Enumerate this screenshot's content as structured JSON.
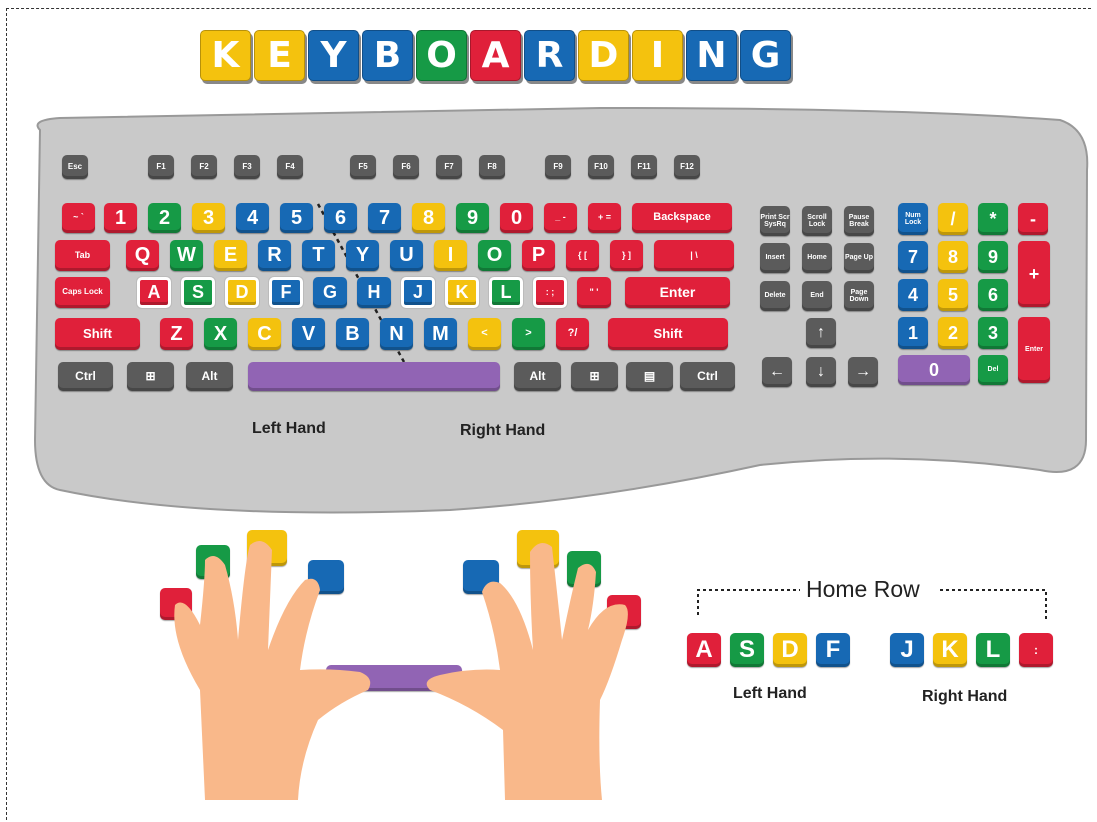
{
  "title": {
    "letters": [
      {
        "char": "K",
        "color": "#f4c20e"
      },
      {
        "char": "E",
        "color": "#f4c20e"
      },
      {
        "char": "Y",
        "color": "#1769b4"
      },
      {
        "char": "B",
        "color": "#1769b4"
      },
      {
        "char": "O",
        "color": "#169a46"
      },
      {
        "char": "A",
        "color": "#e0203a"
      },
      {
        "char": "R",
        "color": "#1769b4"
      },
      {
        "char": "D",
        "color": "#f4c20e"
      },
      {
        "char": "I",
        "color": "#f4c20e"
      },
      {
        "char": "N",
        "color": "#1769b4"
      },
      {
        "char": "G",
        "color": "#1769b4"
      }
    ]
  },
  "colors": {
    "red": "#e0203a",
    "green": "#169a46",
    "yellow": "#f4c20e",
    "blue": "#1769b4",
    "gray": "#5b5b5b",
    "purple": "#9164b4",
    "keyboard_body": "#c9c9c9",
    "skin": "#f9b88a"
  },
  "keyboard": {
    "rows": [
      [
        {
          "label": "Esc",
          "color": "gray"
        },
        {
          "label": "F1",
          "color": "gray"
        },
        {
          "label": "F2",
          "color": "gray"
        },
        {
          "label": "F3",
          "color": "gray"
        },
        {
          "label": "F4",
          "color": "gray"
        },
        {
          "label": "F5",
          "color": "gray"
        },
        {
          "label": "F6",
          "color": "gray"
        },
        {
          "label": "F7",
          "color": "gray"
        },
        {
          "label": "F8",
          "color": "gray"
        },
        {
          "label": "F9",
          "color": "gray"
        },
        {
          "label": "F10",
          "color": "gray"
        },
        {
          "label": "F11",
          "color": "gray"
        },
        {
          "label": "F12",
          "color": "gray"
        }
      ],
      [
        {
          "label": "~ `",
          "color": "red"
        },
        {
          "label": "1",
          "color": "red"
        },
        {
          "label": "2",
          "color": "green"
        },
        {
          "label": "3",
          "color": "yellow"
        },
        {
          "label": "4",
          "color": "blue"
        },
        {
          "label": "5",
          "color": "blue"
        },
        {
          "label": "6",
          "color": "blue"
        },
        {
          "label": "7",
          "color": "blue"
        },
        {
          "label": "8",
          "color": "yellow"
        },
        {
          "label": "9",
          "color": "green"
        },
        {
          "label": "0",
          "color": "red"
        },
        {
          "label": "_ -",
          "color": "red"
        },
        {
          "label": "+ =",
          "color": "red"
        },
        {
          "label": "Backspace",
          "color": "red"
        }
      ],
      [
        {
          "label": "Tab",
          "color": "red"
        },
        {
          "label": "Q",
          "color": "red"
        },
        {
          "label": "W",
          "color": "green"
        },
        {
          "label": "E",
          "color": "yellow"
        },
        {
          "label": "R",
          "color": "blue"
        },
        {
          "label": "T",
          "color": "blue"
        },
        {
          "label": "Y",
          "color": "blue"
        },
        {
          "label": "U",
          "color": "blue"
        },
        {
          "label": "I",
          "color": "yellow"
        },
        {
          "label": "O",
          "color": "green"
        },
        {
          "label": "P",
          "color": "red"
        },
        {
          "label": "{ [",
          "color": "red"
        },
        {
          "label": "} ]",
          "color": "red"
        },
        {
          "label": "| \\",
          "color": "red"
        }
      ],
      [
        {
          "label": "Caps Lock",
          "color": "red"
        },
        {
          "label": "A",
          "color": "red"
        },
        {
          "label": "S",
          "color": "green"
        },
        {
          "label": "D",
          "color": "yellow"
        },
        {
          "label": "F",
          "color": "blue"
        },
        {
          "label": "G",
          "color": "blue"
        },
        {
          "label": "H",
          "color": "blue"
        },
        {
          "label": "J",
          "color": "blue"
        },
        {
          "label": "K",
          "color": "yellow"
        },
        {
          "label": "L",
          "color": "green"
        },
        {
          "label": ": ;",
          "color": "red"
        },
        {
          "label": "\" '",
          "color": "red"
        },
        {
          "label": "Enter",
          "color": "red"
        }
      ],
      [
        {
          "label": "Shift",
          "color": "red"
        },
        {
          "label": "Z",
          "color": "red"
        },
        {
          "label": "X",
          "color": "green"
        },
        {
          "label": "C",
          "color": "yellow"
        },
        {
          "label": "V",
          "color": "blue"
        },
        {
          "label": "B",
          "color": "blue"
        },
        {
          "label": "N",
          "color": "blue"
        },
        {
          "label": "M",
          "color": "blue"
        },
        {
          "label": "<",
          "color": "yellow"
        },
        {
          "label": ">",
          "color": "green"
        },
        {
          "label": "?/",
          "color": "red"
        },
        {
          "label": "Shift",
          "color": "red"
        }
      ],
      [
        {
          "label": "Ctrl",
          "color": "gray"
        },
        {
          "label": "⊞",
          "color": "gray"
        },
        {
          "label": "Alt",
          "color": "gray"
        },
        {
          "label": "",
          "color": "purple"
        },
        {
          "label": "Alt",
          "color": "gray"
        },
        {
          "label": "⊞",
          "color": "gray"
        },
        {
          "label": "▤",
          "color": "gray"
        },
        {
          "label": "Ctrl",
          "color": "gray"
        }
      ]
    ],
    "nav_keys": [
      {
        "label": "Print Scr SysRq",
        "color": "gray"
      },
      {
        "label": "Scroll Lock",
        "color": "gray"
      },
      {
        "label": "Pause Break",
        "color": "gray"
      },
      {
        "label": "Insert",
        "color": "gray"
      },
      {
        "label": "Home",
        "color": "gray"
      },
      {
        "label": "Page Up",
        "color": "gray"
      },
      {
        "label": "Delete",
        "color": "gray"
      },
      {
        "label": "End",
        "color": "gray"
      },
      {
        "label": "Page Down",
        "color": "gray"
      },
      {
        "label": "↑",
        "color": "gray"
      },
      {
        "label": "←",
        "color": "gray"
      },
      {
        "label": "↓",
        "color": "gray"
      },
      {
        "label": "→",
        "color": "gray"
      }
    ],
    "numpad_keys": [
      {
        "label": "Num Lock",
        "color": "blue"
      },
      {
        "label": "/",
        "color": "yellow"
      },
      {
        "label": "*",
        "color": "green"
      },
      {
        "label": "-",
        "color": "red"
      },
      {
        "label": "7",
        "color": "blue"
      },
      {
        "label": "8",
        "color": "yellow"
      },
      {
        "label": "9",
        "color": "green"
      },
      {
        "label": "+",
        "color": "red"
      },
      {
        "label": "4",
        "color": "blue"
      },
      {
        "label": "5",
        "color": "yellow"
      },
      {
        "label": "6",
        "color": "green"
      },
      {
        "label": "1",
        "color": "blue"
      },
      {
        "label": "2",
        "color": "yellow"
      },
      {
        "label": "3",
        "color": "green"
      },
      {
        "label": "Enter",
        "color": "red"
      },
      {
        "label": "0",
        "color": "purple"
      },
      {
        "label": "Del",
        "color": "green"
      }
    ],
    "left_hand_label": "Left Hand",
    "right_hand_label": "Right Hand"
  },
  "home_row": {
    "title": "Home Row",
    "left_keys": [
      {
        "label": "A",
        "color": "red"
      },
      {
        "label": "S",
        "color": "green"
      },
      {
        "label": "D",
        "color": "yellow"
      },
      {
        "label": "F",
        "color": "blue"
      }
    ],
    "right_keys": [
      {
        "label": "J",
        "color": "blue"
      },
      {
        "label": "K",
        "color": "yellow"
      },
      {
        "label": "L",
        "color": "green"
      },
      {
        "label": ":",
        "color": "red"
      }
    ],
    "left_label": "Left Hand",
    "right_label": "Right Hand"
  }
}
